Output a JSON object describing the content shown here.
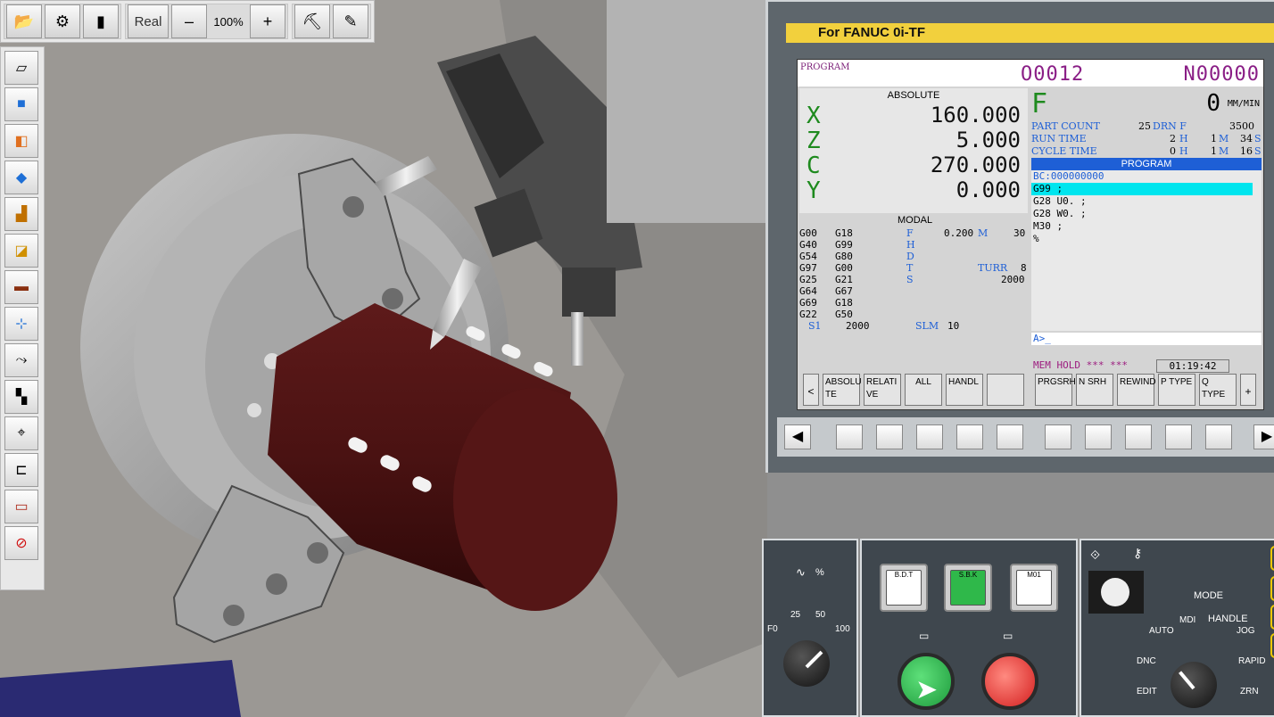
{
  "toolbar": {
    "real_label": "Real",
    "zoom_out_label": "–",
    "zoom_level": "100%",
    "zoom_in_label": "+"
  },
  "cnc": {
    "title": "For FANUC 0i-TF",
    "program_label": "PROGRAM",
    "program_no": "O0012",
    "sequence_no": "N00000",
    "absolute_title": "ABSOLUTE",
    "axes": [
      {
        "name": "X",
        "value": "160.000"
      },
      {
        "name": "Z",
        "value": "5.000"
      },
      {
        "name": "C",
        "value": "270.000"
      },
      {
        "name": "Y",
        "value": "0.000"
      }
    ],
    "feed_letter": "F",
    "feed_value": "0",
    "feed_unit": "MM/MIN",
    "counters": [
      {
        "label": "PART COUNT",
        "n1": "25",
        "u1": "DRN F",
        "n2": "",
        "u2": "",
        "n3": "3500",
        "u3": ""
      },
      {
        "label": "RUN TIME",
        "n1": "",
        "u1": "",
        "n2": "2",
        "u2": "H",
        "n3": "1",
        "u3": "M",
        "n4": "34",
        "u4": "S"
      },
      {
        "label": "CYCLE TIME",
        "n1": "",
        "u1": "",
        "n2": "0",
        "u2": "H",
        "n3": "1",
        "u3": "M",
        "n4": "16",
        "u4": "S"
      }
    ],
    "program_panel_title": "PROGRAM",
    "program_lines": [
      "BC:000000000",
      "G99 ;",
      "G28 U0. ;",
      "G28 W0. ;",
      "M30 ;",
      "%"
    ],
    "modal_title": "MODAL",
    "modal_col1": [
      "G00",
      "G40",
      "G54",
      "G97",
      "G25",
      "G64",
      "G69",
      "G22"
    ],
    "modal_col2": [
      "G18",
      "G99",
      "G80",
      "G00",
      "G21",
      "G67",
      "G18",
      "G50"
    ],
    "modal_labels": [
      "F",
      "H",
      "D",
      "T",
      "S"
    ],
    "modal_f_value": "0.200",
    "modal_m_label": "M",
    "modal_m_value": "30",
    "modal_turr_label": "TURR",
    "modal_turr_value": "8",
    "modal_s_value": "2000",
    "s1_label": "S1",
    "s1_value": "2000",
    "slm_label": "SLM",
    "slm_value": "10",
    "input_prompt": "A>_",
    "status_mode": "MEM HOLD *** ***",
    "status_time": "01:19:42",
    "softkeys": [
      "ABSOLU TE",
      "RELATI VE",
      "ALL",
      "HANDL",
      "",
      "PRGSRH",
      "N SRH",
      "REWIND",
      "P TYPE",
      "Q TYPE"
    ],
    "softkey_prev": "<",
    "softkey_next": "+"
  },
  "operator": {
    "override_label": "%",
    "override_ticks": [
      "F0",
      "25",
      "50",
      "100"
    ],
    "bdt_label": "B.D.T",
    "sbk_label": "S.B.K",
    "m01_label": "M01",
    "mode_title": "MODE",
    "modes": [
      "AUTO",
      "MDI",
      "HANDLE",
      "JOG",
      "DNC",
      "RAPID",
      "EDIT",
      "ZRN"
    ]
  }
}
